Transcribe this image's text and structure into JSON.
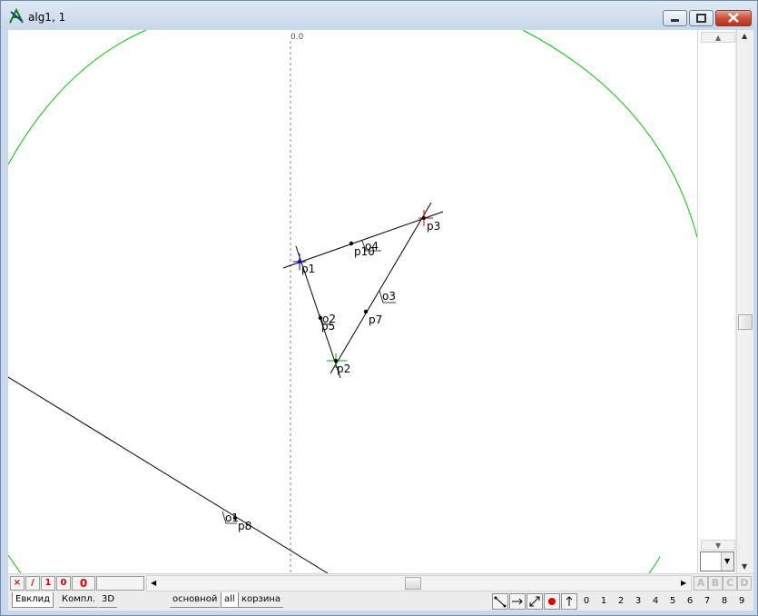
{
  "window": {
    "title": "alg1, 1"
  },
  "canvas": {
    "axis_label": "0.0",
    "colors": {
      "circle": "#00c800",
      "line": "#000000",
      "axis": "#808080",
      "p1_cross": "#0000c0",
      "p2_cross": "#00a000",
      "p3_cross": "#d00000"
    },
    "points": [
      {
        "label": "p1"
      },
      {
        "label": "p2"
      },
      {
        "label": "p3"
      },
      {
        "label": "p10"
      },
      {
        "label": "p5"
      },
      {
        "label": "p7"
      },
      {
        "label": "p8"
      }
    ],
    "lines": [
      {
        "label": "o4"
      },
      {
        "label": "o2"
      },
      {
        "label": "o3"
      },
      {
        "label": "o1"
      }
    ]
  },
  "status_buttons": [
    {
      "label": "×",
      "icon": "close-x-icon"
    },
    {
      "label": "/",
      "icon": "slash-icon"
    },
    {
      "label": "1"
    },
    {
      "label": "0"
    },
    {
      "label": "0"
    }
  ],
  "corner_letters": [
    "A",
    "B",
    "C",
    "D"
  ],
  "tabs_left": [
    "Евклид",
    "Компл.",
    "3D"
  ],
  "tabs_right": [
    "основной",
    "all",
    "корзина"
  ],
  "tools": [
    "segment-tool-icon",
    "arrow-right-icon",
    "diagonal-arrow-icon",
    "record-dot-icon",
    "arrow-up-icon"
  ],
  "num_keys": [
    "0",
    "1",
    "2",
    "3",
    "4",
    "5",
    "6",
    "7",
    "8",
    "9"
  ]
}
